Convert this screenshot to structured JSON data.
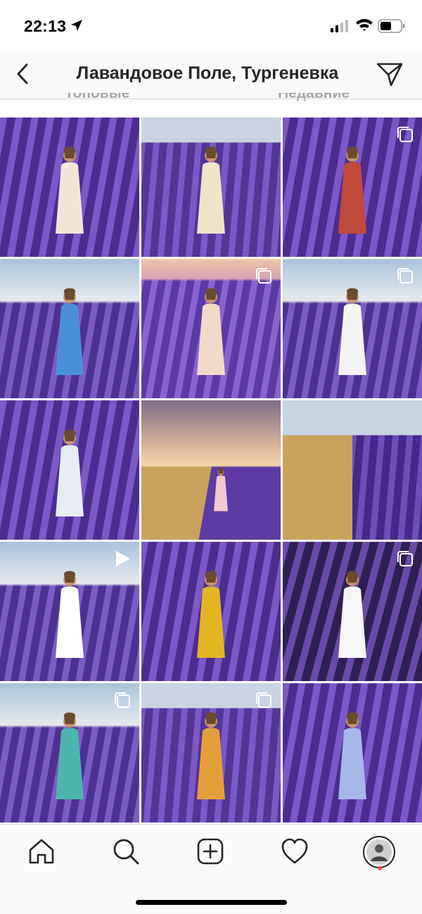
{
  "status_bar": {
    "time": "22:13"
  },
  "header": {
    "title": "Лавандовое Поле, Тургеневка"
  },
  "tabs": [
    {
      "label": "Топовые"
    },
    {
      "label": "Недавние"
    }
  ],
  "grid": {
    "tiles": [
      {
        "name": "tile-girl-with-basket",
        "scene": "lavender",
        "badge": "none"
      },
      {
        "name": "tile-picnic-basket",
        "scene": "lavender-sky",
        "badge": "none"
      },
      {
        "name": "tile-man-with-backpack",
        "scene": "lavender",
        "badge": "carousel"
      },
      {
        "name": "tile-couple-in-field",
        "scene": "sky-field",
        "badge": "none"
      },
      {
        "name": "tile-woman-in-field",
        "scene": "sunset-lavender",
        "badge": "carousel"
      },
      {
        "name": "tile-woman-white-shirt",
        "scene": "sky-field",
        "badge": "carousel"
      },
      {
        "name": "tile-blonde-woman-bouquet",
        "scene": "lavender",
        "badge": "none"
      },
      {
        "name": "tile-sunset-girl-running",
        "scene": "sunset-wheat",
        "badge": "none"
      },
      {
        "name": "tile-wheat-and-lavender",
        "scene": "wheat-lavender",
        "badge": "none"
      },
      {
        "name": "tile-soap-bubble-video",
        "scene": "sky-field",
        "badge": "video"
      },
      {
        "name": "tile-woman-yellow-dress",
        "scene": "lavender",
        "badge": "none"
      },
      {
        "name": "tile-woman-white-gown",
        "scene": "dark-lavender",
        "badge": "carousel"
      },
      {
        "name": "tile-woman-teal-dress",
        "scene": "sky-field",
        "badge": "carousel"
      },
      {
        "name": "tile-woman-straw-hat",
        "scene": "lavender-sky",
        "badge": "carousel"
      },
      {
        "name": "tile-woman-holding-hat",
        "scene": "lavender",
        "badge": "none"
      }
    ]
  },
  "bottom_nav": [
    {
      "name": "home",
      "icon": "home-icon"
    },
    {
      "name": "search",
      "icon": "search-icon"
    },
    {
      "name": "new-post",
      "icon": "plus-square-icon"
    },
    {
      "name": "activity",
      "icon": "heart-icon"
    },
    {
      "name": "profile",
      "icon": "avatar-icon"
    }
  ],
  "colors": {
    "lavender": "#6b49b5",
    "sky": "#c9d3e3",
    "wheat": "#c9a25c",
    "accent_dot": "#ed4956"
  }
}
